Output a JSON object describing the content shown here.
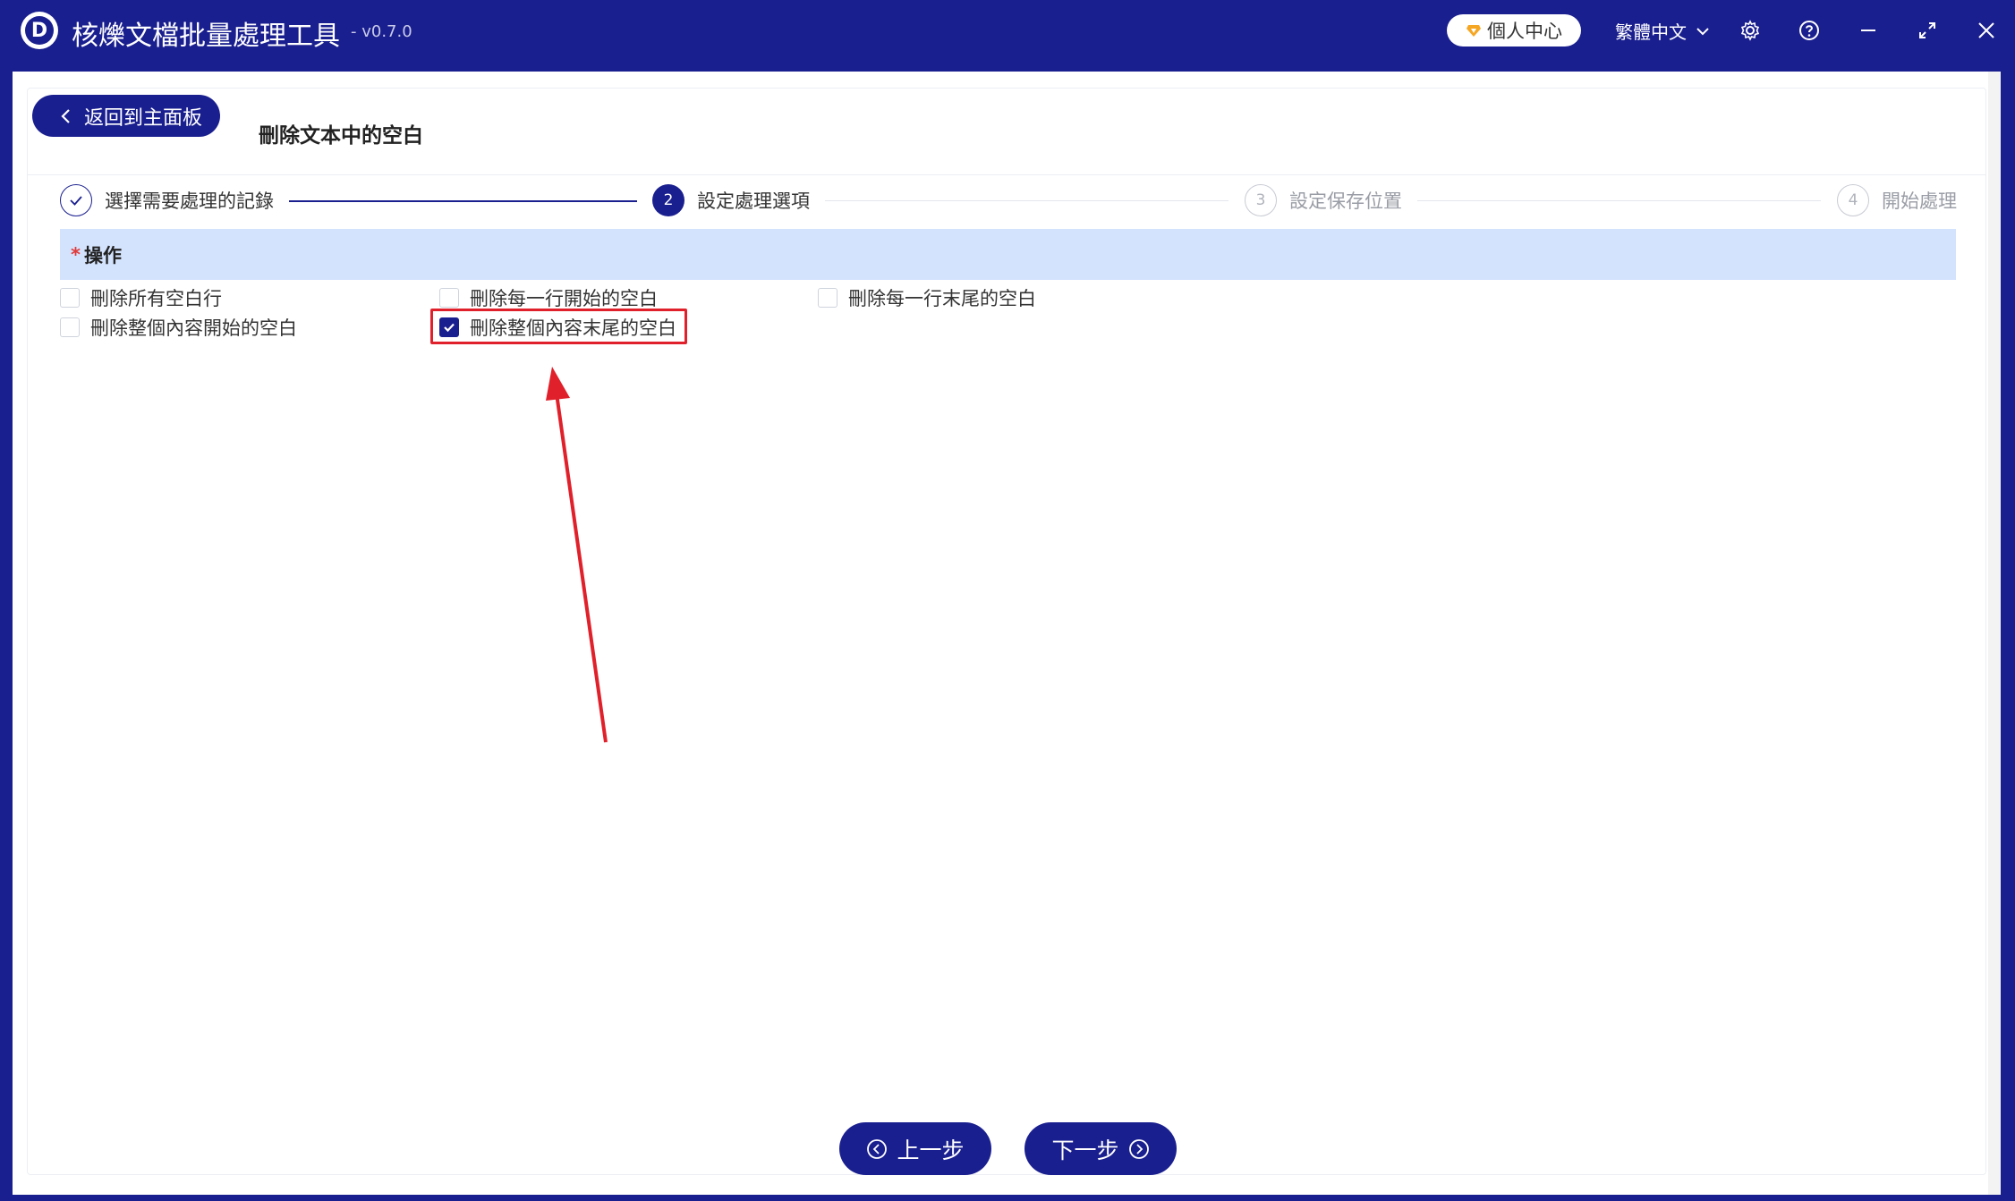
{
  "app": {
    "logo_letter": "D",
    "title": "核爍文檔批量處理工具",
    "version": "- v0.7.0",
    "user_center": "個人中心",
    "language": "繁體中文"
  },
  "header": {
    "back_label": "返回到主面板",
    "page_title": "刪除文本中的空白"
  },
  "steps": [
    {
      "number": "1",
      "label": "選擇需要處理的記錄",
      "state": "done"
    },
    {
      "number": "2",
      "label": "設定處理選項",
      "state": "active"
    },
    {
      "number": "3",
      "label": "設定保存位置",
      "state": "pending"
    },
    {
      "number": "4",
      "label": "開始處理",
      "state": "pending"
    }
  ],
  "operation": {
    "required_mark": "*",
    "title": "操作",
    "options": [
      {
        "label": "刪除所有空白行",
        "checked": false
      },
      {
        "label": "刪除每一行開始的空白",
        "checked": false
      },
      {
        "label": "刪除每一行末尾的空白",
        "checked": false
      },
      {
        "label": "刪除整個內容開始的空白",
        "checked": false
      },
      {
        "label": "刪除整個內容末尾的空白",
        "checked": true
      }
    ]
  },
  "footer": {
    "prev_label": "上一步",
    "next_label": "下一步"
  },
  "colors": {
    "primary": "#1a1f8f",
    "section_bg": "#d4e3fd",
    "annotation": "#e0202a"
  },
  "icons": [
    "diamond-icon",
    "chevron-down-icon",
    "gear-icon",
    "help-icon",
    "minimize-icon",
    "maximize-icon",
    "close-icon",
    "chevron-left-icon",
    "check-icon",
    "arrow-left-circle-icon",
    "arrow-right-circle-icon"
  ]
}
